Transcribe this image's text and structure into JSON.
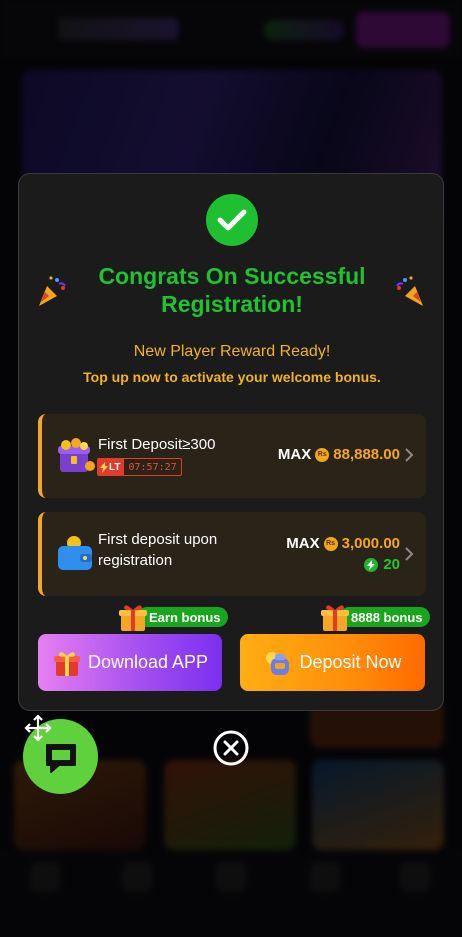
{
  "modal": {
    "title": "Congrats On Successful Registration!",
    "subtitle": "New Player Reward Ready!",
    "subtitle_secondary": "Top up now to activate your welcome bonus.",
    "offers": [
      {
        "title": "First Deposit≥300",
        "badge": "LT",
        "timer": "07:57:27",
        "max_label": "MAX",
        "currency_icon": "rupee-coin-icon",
        "currency_text": "Rs",
        "max_amount": "88,888.00"
      },
      {
        "title": "First deposit upon registration",
        "max_label": "MAX",
        "currency_icon": "rupee-coin-icon",
        "currency_text": "Rs",
        "max_amount": "3,000.00",
        "bonus_icon": "bolt-coin-icon",
        "bonus_amount": "20"
      }
    ],
    "download_tag": "Earn bonus",
    "deposit_tag": "8888 bonus",
    "download_button": "Download APP",
    "deposit_button": "Deposit Now"
  },
  "colors": {
    "success_green": "#1fc22f",
    "accent_gold": "#f2b31d",
    "offer_accent": "#f5a623",
    "download_gradient_start": "#e77ff1",
    "download_gradient_end": "#7b2ff0",
    "deposit_gradient_start": "#ffae12",
    "deposit_gradient_end": "#ff6a00",
    "chat_fab": "#5fd13c"
  },
  "icons": {
    "success": "check-circle-icon",
    "party_left": "party-popper-icon",
    "party_right": "party-popper-icon",
    "offer_1": "treasure-box-icon",
    "offer_2": "wallet-icon",
    "gift": "gift-icon",
    "download": "gift-box-icon",
    "deposit": "coin-bag-icon",
    "close": "close-circle-icon",
    "chat": "chat-bubble-icon",
    "move": "move-arrows-icon"
  }
}
